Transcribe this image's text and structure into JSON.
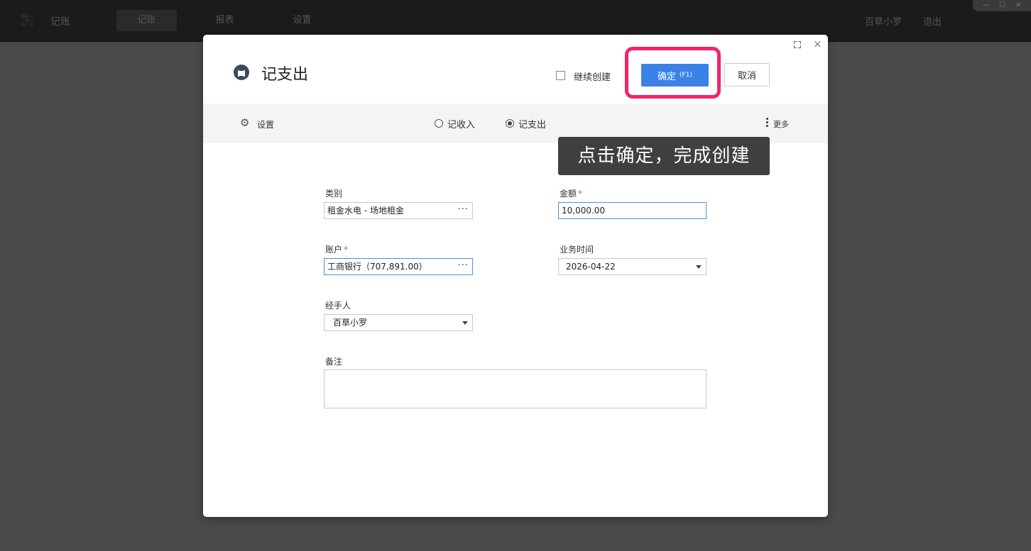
{
  "topbar": {
    "app_name": "记账",
    "tabs": [
      {
        "label": "记账",
        "active": true
      },
      {
        "label": "报表",
        "active": false
      },
      {
        "label": "设置",
        "active": false
      }
    ],
    "user_name": "百草小罗",
    "logout_label": "退出"
  },
  "dialog": {
    "title": "记支出",
    "continue_create_label": "继续创建",
    "continue_create_checked": false,
    "confirm_label": "确定",
    "confirm_hotkey": "(F1)",
    "cancel_label": "取消",
    "toolbar": {
      "settings_label": "设置",
      "radio_income_label": "记收入",
      "radio_expense_label": "记支出",
      "selected": "记支出",
      "more_label": "更多"
    },
    "tooltip": "点击确定，完成创建",
    "form": {
      "category": {
        "label": "类别",
        "value": "租金水电 - 场地租金"
      },
      "amount": {
        "label": "金额",
        "required": true,
        "value": "10,000.00"
      },
      "account": {
        "label": "账户",
        "required": true,
        "value": "工商银行（707,891.00）"
      },
      "business_time": {
        "label": "业务时间",
        "value": "2026-04-22"
      },
      "handler": {
        "label": "经手人",
        "value": "百草小罗"
      },
      "remark": {
        "label": "备注",
        "value": ""
      }
    }
  },
  "colors": {
    "primary": "#3b82e8",
    "highlight": "#f2246a",
    "required": "#d9534f",
    "backdrop": "#4a4a4a"
  }
}
